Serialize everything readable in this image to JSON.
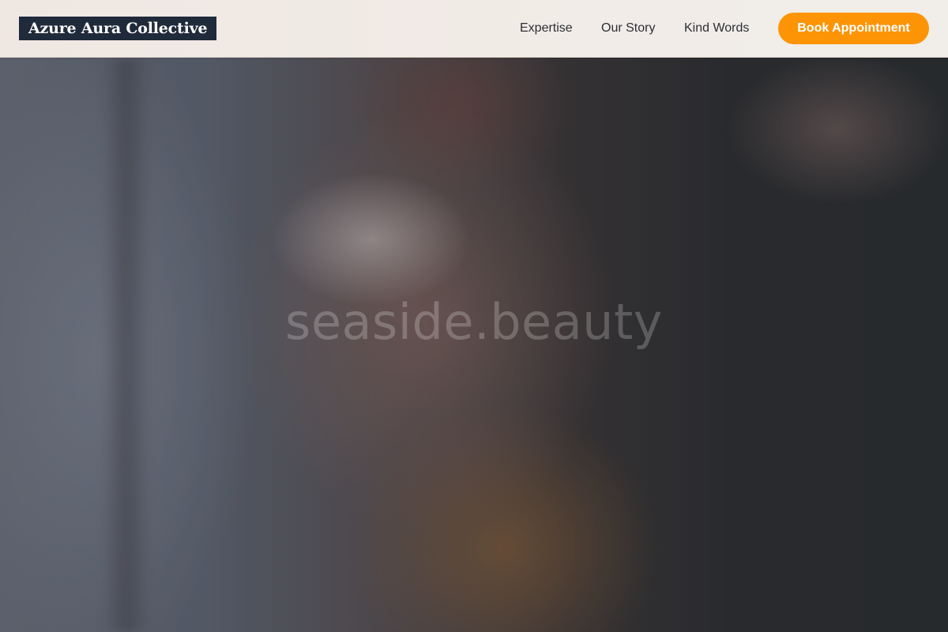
{
  "header": {
    "logo_text": "Azure Aura Collective",
    "nav": [
      {
        "label": "Expertise"
      },
      {
        "label": "Our Story"
      },
      {
        "label": "Kind Words"
      }
    ],
    "cta_label": "Book Appointment"
  },
  "hero": {
    "watermark": "seaside.beauty"
  },
  "colors": {
    "logo_bg": "#1f2a3a",
    "cta_bg": "#fc9406",
    "header_bg": "#f1ebe6"
  }
}
